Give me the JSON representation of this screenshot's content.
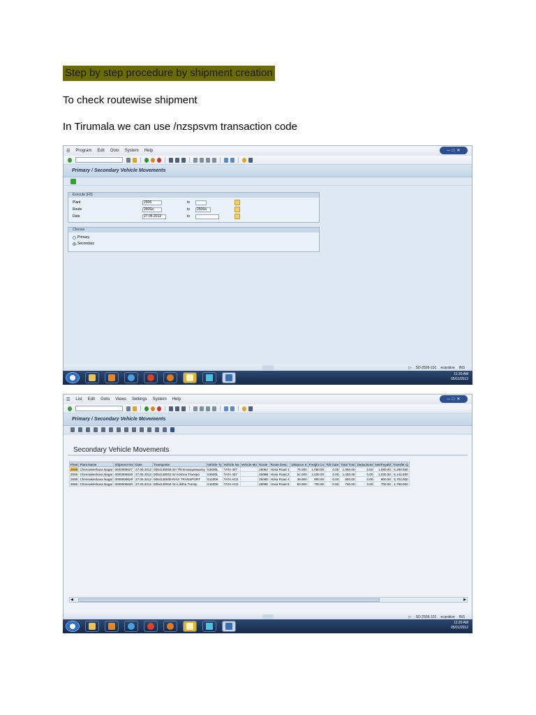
{
  "doc": {
    "heading": "Step by step procedure by shipment creation",
    "line1": "To check routewise shipment",
    "line2": "In Tirumala we can use /nzspsvm transaction code"
  },
  "screen1": {
    "menu": [
      "Program",
      "Edit",
      "Goto",
      "System",
      "Help"
    ],
    "title": "Primary / Secondary Vehicle Movements",
    "group1_label": "Execute (F8)",
    "fields": [
      {
        "label": "Plant",
        "from": "2506",
        "to_label": "to",
        "to": ""
      },
      {
        "label": "Route",
        "from": "2506a",
        "to_label": "to",
        "to": "2506a"
      },
      {
        "label": "Date",
        "from": "27.05.2012",
        "to_label": "to",
        "to": ""
      }
    ],
    "group2_label": "Choose",
    "radios": [
      {
        "label": "Primary",
        "selected": false
      },
      {
        "label": "Secondary",
        "selected": true
      }
    ],
    "status": "SD-2506-101",
    "user": "ecqrative",
    "mode": "INS",
    "clock_time": "11:20 AM",
    "clock_date": "05/01/2012"
  },
  "screen2": {
    "menu": [
      "List",
      "Edit",
      "Goto",
      "Views",
      "Settings",
      "System",
      "Help"
    ],
    "title": "Primary / Secondary Vehicle Movements",
    "report_title": "Secondary Vehicle Movements",
    "columns": [
      "Plant",
      "Plant Name",
      "Shipment No",
      "Date",
      "Transporter",
      "Vehicle Ty",
      "Vehicle No",
      "Vehicle Mo",
      "Route",
      "Route Desc",
      "Distance K",
      "Freight Co",
      "Toll Gate",
      "Total Tran",
      "Deductions",
      "Net/Payabl",
      "Transfer Q"
    ],
    "rows": [
      [
        "2506",
        "Chennakeshava Nagar",
        "0000006627",
        "27.05.2012",
        "0054130006-Sri Thimmarayaswamy",
        "S3600L",
        "TATA 407",
        "",
        "2506A",
        "Hosa Road 1",
        "76.000",
        "1,080.00",
        "0.00",
        "1,080.00",
        "0.00",
        "1,080.00",
        "6,290.500"
      ],
      [
        "2506",
        "Chennakeshava Nagar",
        "0000006628",
        "27.05.2012",
        "0054130001-Sri Kishna Transpo",
        "S3600L",
        "TATA 407",
        "",
        "2506B",
        "Hosa Road 2",
        "51.000",
        "1,030.00",
        "0.00",
        "1,030.00",
        "0.00",
        "1,030.00",
        "6,142.500"
      ],
      [
        "2506",
        "Chennakeshava Nagar",
        "0000006629",
        "27.05.2012",
        "0054130005-RAVI TRANSPORT",
        "S1100K",
        "TATA ACE",
        "",
        "2506D",
        "Hosa Road 4",
        "39.000",
        "900.00",
        "0.00",
        "900.00",
        "0.00",
        "900.00",
        "5,704.000"
      ],
      [
        "2506",
        "Chennakeshava Nagar",
        "0000006630",
        "27.05.2012",
        "0054130004-Sri Likitha Transp",
        "S1100K",
        "TATA ACE",
        "",
        "2506E",
        "Hosa Road 5",
        "50.000",
        "700.00",
        "0.00",
        "700.00",
        "0.00",
        "700.00",
        "1,798.000"
      ]
    ],
    "status": "SD-2506-101",
    "user": "ecqrative",
    "mode": "INS",
    "clock_time": "11:20 AM",
    "clock_date": "05/01/2012"
  }
}
